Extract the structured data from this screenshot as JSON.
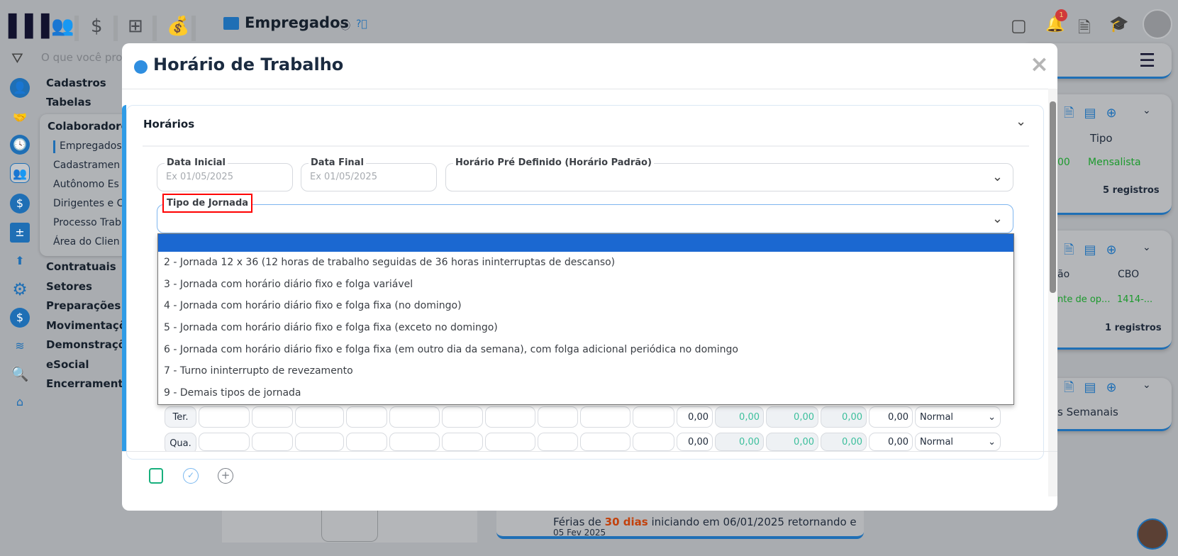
{
  "header": {
    "title": "Empregados",
    "notification_count": "1",
    "search_placeholder": "O que você pro"
  },
  "sidebar": {
    "menu": [
      "Cadastros",
      "Tabelas"
    ],
    "group": "Colaboradore",
    "group_items": [
      "Empregados",
      "Cadastramen",
      "Autônomo Es",
      "Dirigentes e C",
      "Processo Trab",
      "Área do Clien"
    ],
    "menu_after": [
      "Contratuais",
      "Setores",
      "Preparações",
      "Movimentaçõ",
      "Demonstraçõ",
      "eSocial",
      "Encerramento"
    ]
  },
  "background_cards": {
    "card2_col": "Tipo",
    "card2_value": "Mensalista",
    "card2_partial": "00",
    "card2_count": "5 registros",
    "card3_col1": "ão",
    "card3_col2": "CBO",
    "card3_val1": "nte de op...",
    "card3_val2": "1414-...",
    "card3_count": "1 registros",
    "card4_label": "s Semanais",
    "ferias_pre": "Férias de ",
    "ferias_days": "30 dias",
    "ferias_post": " iniciando em 06/01/2025 retornando e",
    "ferias_date": "05 Fev 2025"
  },
  "modal": {
    "title": "Horário de Trabalho",
    "close": "×",
    "section": "Horários",
    "fields": {
      "data_inicial_label": "Data Inicial",
      "data_inicial_ph": "Ex 01/05/2025",
      "data_final_label": "Data Final",
      "data_final_ph": "Ex 01/05/2025",
      "predef_label": "Horário Pré Definido (Horário Padrão)",
      "tipo_label": "Tipo de Jornada"
    },
    "tipo_options": [
      "2 - Jornada 12 x 36 (12 horas de trabalho seguidas de 36 horas ininterruptas de descanso)",
      "3 - Jornada com horário diário fixo e folga variável",
      "4 - Jornada com horário diário fixo e folga fixa (no domingo)",
      "5 - Jornada com horário diário fixo e folga fixa (exceto no domingo)",
      "6 - Jornada com horário diário fixo e folga fixa (em outro dia da semana), com folga adicional periódica no domingo",
      "7 - Turno ininterrupto de revezamento",
      "9 - Demais tipos de jornada"
    ],
    "rows": [
      {
        "day": "Ter.",
        "v1": "0,00",
        "v2": "0,00",
        "v3": "0,00",
        "v4": "0,00",
        "v5": "0,00",
        "type": "Normal"
      },
      {
        "day": "Qua.",
        "v1": "0,00",
        "v2": "0,00",
        "v3": "0,00",
        "v4": "0,00",
        "v5": "0,00",
        "type": "Normal"
      }
    ]
  },
  "colors": {
    "accent": "#1f6fb5",
    "selected": "#1b68d1",
    "green": "#3cbf9c",
    "highlight": "#ff0000"
  }
}
